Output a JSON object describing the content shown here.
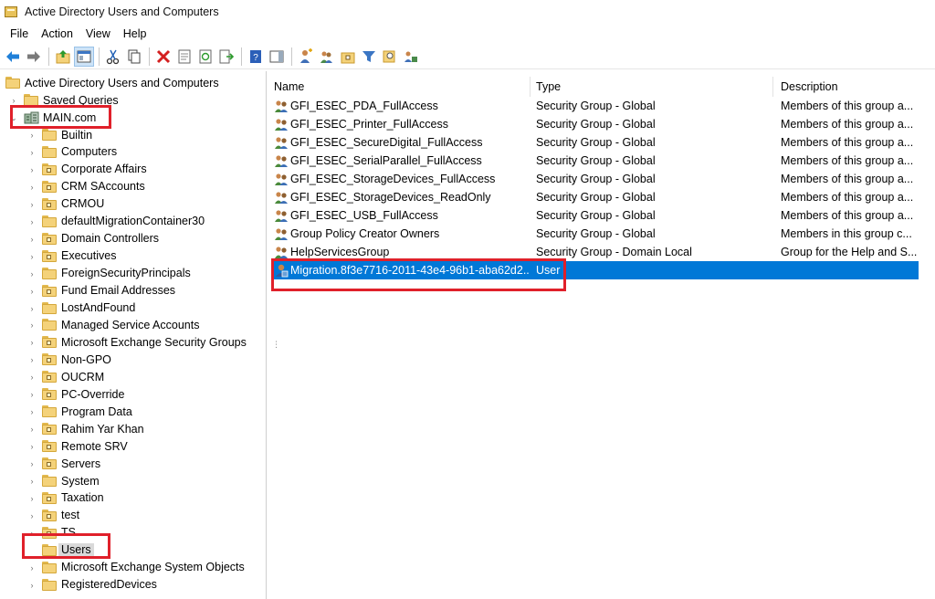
{
  "window": {
    "title": "Active Directory Users and Computers"
  },
  "menu": [
    {
      "label": "File"
    },
    {
      "label": "Action"
    },
    {
      "label": "View"
    },
    {
      "label": "Help"
    }
  ],
  "toolbar": {
    "buttons": [
      "back-arrow-icon",
      "forward-arrow-icon",
      "up-folder-icon",
      "show-console-tree-icon",
      "cut-icon",
      "copy-icon",
      "delete-icon",
      "properties-icon",
      "refresh-icon",
      "export-list-icon",
      "help-icon",
      "action-pane-icon",
      "new-user-icon",
      "new-group-icon",
      "new-ou-icon",
      "filter-icon",
      "find-icon",
      "add-to-group-icon"
    ]
  },
  "tree": {
    "root": "Active Directory Users and Computers",
    "saved_queries": "Saved Queries",
    "domain": "MAIN.com",
    "children": [
      "Builtin",
      "Computers",
      "Corporate Affairs",
      "CRM SAccounts",
      "CRMOU",
      "defaultMigrationContainer30",
      "Domain Controllers",
      "Executives",
      "ForeignSecurityPrincipals",
      "Fund Email Addresses",
      "LostAndFound",
      "Managed Service Accounts",
      "Microsoft Exchange Security Groups",
      "Non-GPO",
      "OUCRM",
      "PC-Override",
      "Program Data",
      "Rahim Yar Khan",
      "Remote SRV",
      "Servers",
      "System",
      "Taxation",
      "test",
      "TS",
      "Users",
      "Microsoft Exchange System Objects",
      "RegisteredDevices"
    ],
    "selected": "Users"
  },
  "list": {
    "columns": {
      "name": "Name",
      "type": "Type",
      "description": "Description"
    },
    "rows": [
      {
        "name": "GFI_ESEC_PDA_FullAccess",
        "type": "Security Group - Global",
        "description": "Members of this group a..."
      },
      {
        "name": "GFI_ESEC_Printer_FullAccess",
        "type": "Security Group - Global",
        "description": "Members of this group a..."
      },
      {
        "name": "GFI_ESEC_SecureDigital_FullAccess",
        "type": "Security Group - Global",
        "description": "Members of this group a..."
      },
      {
        "name": "GFI_ESEC_SerialParallel_FullAccess",
        "type": "Security Group - Global",
        "description": "Members of this group a..."
      },
      {
        "name": "GFI_ESEC_StorageDevices_FullAccess",
        "type": "Security Group - Global",
        "description": "Members of this group a..."
      },
      {
        "name": "GFI_ESEC_StorageDevices_ReadOnly",
        "type": "Security Group - Global",
        "description": "Members of this group a..."
      },
      {
        "name": "GFI_ESEC_USB_FullAccess",
        "type": "Security Group - Global",
        "description": "Members of this group a..."
      },
      {
        "name": "Group Policy Creator Owners",
        "type": "Security Group - Global",
        "description": "Members in this group c..."
      },
      {
        "name": "HelpServicesGroup",
        "type": "Security Group - Domain Local",
        "description": "Group for the Help and S..."
      },
      {
        "name": "Migration.8f3e7716-2011-43e4-96b1-aba62d2...",
        "type": "User",
        "description": ""
      }
    ],
    "selected_index": 9
  },
  "colors": {
    "selection": "#0078d7",
    "highlight": "#e0202a"
  }
}
